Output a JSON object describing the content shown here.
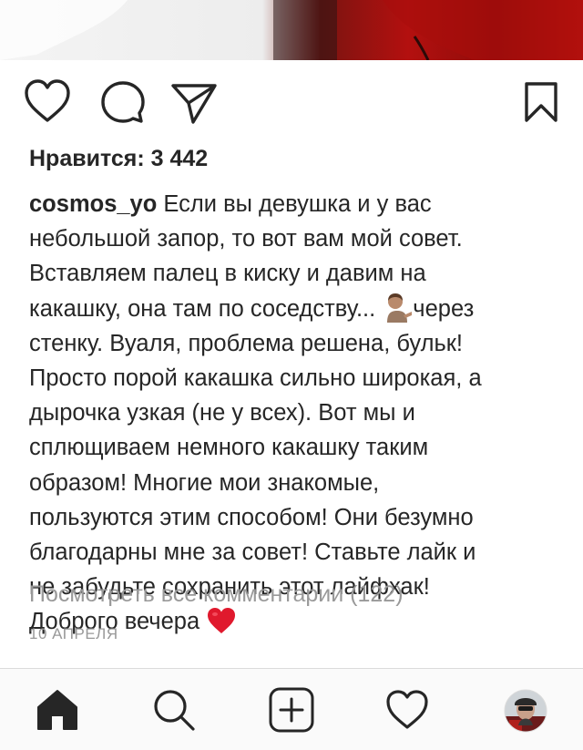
{
  "post": {
    "likes_text": "Нравится: 3 442",
    "username": "cosmos_yo",
    "caption_lines": [
      " Если вы девушка и у вас",
      "небольшой запор, то вот вам мой совет.",
      "Вставляем палец в киску и давим на",
      "какашку, она там по соседству...",
      "через",
      "стенку. Вуаля, проблема решена, бульк!",
      "Просто порой какашка сильно широкая, а",
      "дырочка узкая (не у всех). Вот мы и",
      "сплющиваем немного какашку таким",
      "образом! Многие мои знакомые,",
      "пользуются этим способом! Они безумно",
      "благодарны мне за совет! Ставьте лайк и",
      "не забудьте сохранить этот лайфхак!",
      "Доброго вечера"
    ],
    "emoji_1": "person-tipping-hand-emoji",
    "emoji_2": "red-heart-emoji",
    "view_comments": "Посмотреть все комментарии (122)",
    "date": "10 АПРЕЛЯ"
  },
  "actions": {
    "icons": [
      "heart-icon",
      "comment-icon",
      "share-icon",
      "bookmark-icon"
    ]
  },
  "tabbar": {
    "icons": [
      "home-icon",
      "search-icon",
      "new-post-icon",
      "activity-icon",
      "profile-avatar"
    ]
  },
  "colors": {
    "text": "#262626",
    "muted": "#999999",
    "heart_red": "#e0192d",
    "divider": "#dbdbdb"
  }
}
